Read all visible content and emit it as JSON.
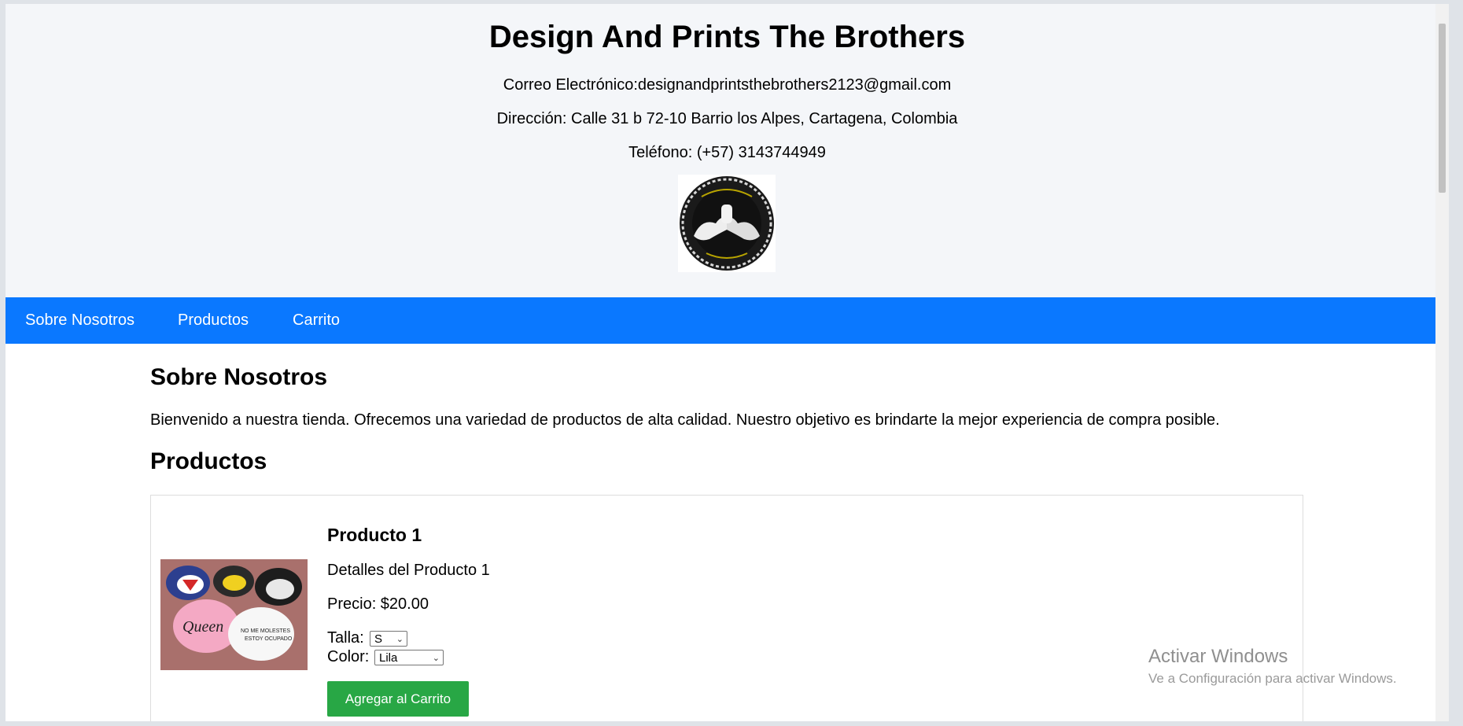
{
  "header": {
    "title": "Design And Prints The Brothers",
    "email": "Correo Electrónico:designandprintsthebrothers2123@gmail.com",
    "address": "Dirección: Calle 31 b 72-10 Barrio los Alpes, Cartagena, Colombia",
    "phone": "Teléfono: (+57) 3143744949",
    "logo_icon": "arm-wrestling-logo"
  },
  "nav": {
    "items": [
      {
        "label": "Sobre Nosotros"
      },
      {
        "label": "Productos"
      },
      {
        "label": "Carrito"
      }
    ],
    "color": "#0a78ff"
  },
  "about": {
    "title": "Sobre Nosotros",
    "text": "Bienvenido a nuestra tienda. Ofrecemos una variedad de productos de alta calidad. Nuestro objetivo es brindarte la mejor experiencia de compra posible."
  },
  "products": {
    "title": "Productos",
    "items": [
      {
        "name": "Producto 1",
        "details": "Detalles del Producto 1",
        "price": "Precio: $20.00",
        "size_label": "Talla:",
        "size_value": "S",
        "color_label": "Color:",
        "color_value": "Lila",
        "add_button": "Agregar al Carrito",
        "image_icon": "caps-photo"
      }
    ]
  },
  "watermark": {
    "title": "Activar Windows",
    "subtitle": "Ve a Configuración para activar Windows."
  },
  "colors": {
    "accent": "#0a78ff",
    "button": "#28a745",
    "header_bg": "#f4f6f9"
  }
}
